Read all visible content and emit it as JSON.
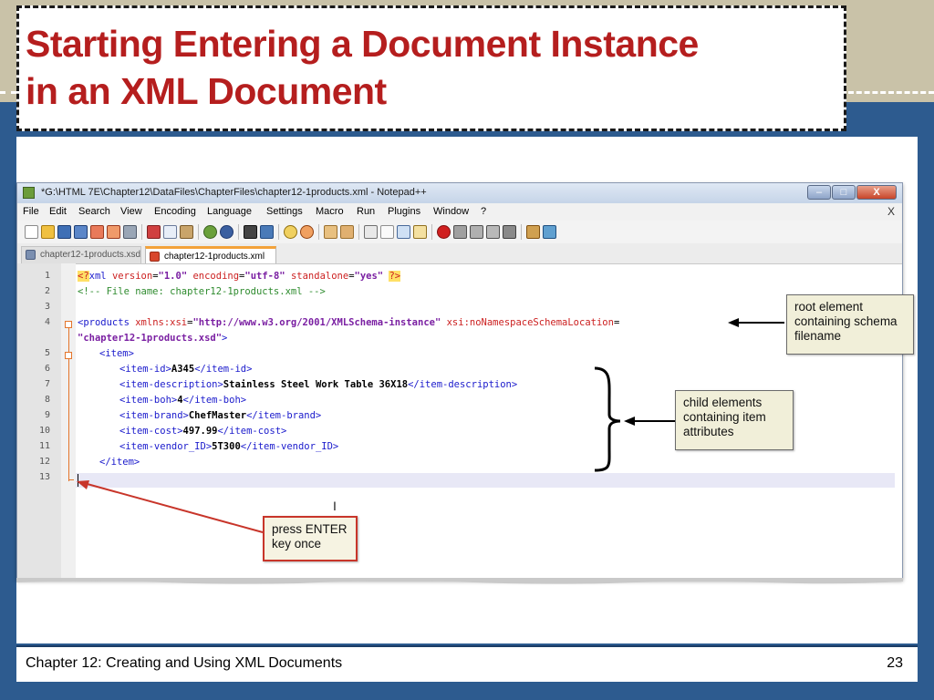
{
  "slide": {
    "title_line1": "Starting Entering a Document Instance",
    "title_line2": "in an XML Document",
    "footer_left": "Chapter 12: Creating and Using XML Documents",
    "page_number": "23",
    "colors": {
      "title": "#b51e1e",
      "band_top": "#c9c2a8",
      "band_blue": "#2d5b8f"
    }
  },
  "window": {
    "title": "*G:\\HTML 7E\\Chapter12\\DataFiles\\ChapterFiles\\chapter12-1products.xml - Notepad++",
    "controls": {
      "minimize": "–",
      "maximize": "□",
      "close": "X"
    },
    "close_doc": "X"
  },
  "menu": [
    "File",
    "Edit",
    "Search",
    "View",
    "Encoding",
    "Language",
    "Settings",
    "Macro",
    "Run",
    "Plugins",
    "Window",
    "?"
  ],
  "tabs": [
    {
      "label": "chapter12-1products.xsd"
    },
    {
      "label": "chapter12-1products.xml"
    }
  ],
  "editor": {
    "line_numbers": [
      "1",
      "2",
      "3",
      "4",
      "",
      "5",
      "6",
      "7",
      "8",
      "9",
      "10",
      "11",
      "12",
      "13"
    ],
    "line1": {
      "open": "<?",
      "tag": "xml",
      "a1": " version",
      "v1": "\"1.0\"",
      "a2": " encoding",
      "v2": "\"utf-8\"",
      "a3": " standalone",
      "v3": "\"yes\"",
      "close": "?>"
    },
    "line2": "<!-- File name: chapter12-1products.xml -->",
    "line4": {
      "tag": "<products",
      "a1": " xmlns:xsi",
      "v1": "\"http://www.w3.org/2001/XMLSchema-instance\"",
      "a2": " xsi:noNamespaceSchemaLocation",
      "eq": "="
    },
    "line4b": {
      "val": "\"chapter12-1products.xsd\"",
      "close": ">"
    },
    "line5": "<item>",
    "rows": [
      {
        "open": "<item-id>",
        "value": "A345",
        "close": "</item-id>"
      },
      {
        "open": "<item-description>",
        "value": "Stainless Steel Work Table 36X18",
        "close": "</item-description>"
      },
      {
        "open": "<item-boh>",
        "value": "4",
        "close": "</item-boh>"
      },
      {
        "open": "<item-brand>",
        "value": "ChefMaster",
        "close": "</item-brand>"
      },
      {
        "open": "<item-cost>",
        "value": "497.99",
        "close": "</item-cost>"
      },
      {
        "open": "<item-vendor_ID>",
        "value": "5T300",
        "close": "</item-vendor_ID>"
      }
    ],
    "line12": "</item>"
  },
  "callouts": {
    "root": "root element containing schema filename",
    "child": "child elements containing item attributes",
    "enter": "press ENTER key once"
  },
  "icons": [
    "new-file-icon",
    "open-icon",
    "save-icon",
    "save-all-icon",
    "close-icon",
    "close-all-icon",
    "print-icon",
    "cut-icon",
    "copy-icon",
    "paste-icon",
    "undo-icon",
    "redo-icon",
    "find-icon",
    "replace-icon",
    "zoom-in-icon",
    "zoom-out-icon",
    "sync-v-icon",
    "sync-h-icon",
    "wrap-icon",
    "all-chars-icon",
    "indent-guide-icon",
    "doc-map-icon",
    "record-macro-icon",
    "stop-macro-icon",
    "play-macro-icon",
    "play-multi-icon",
    "save-macro-icon",
    "launch-icon",
    "spellcheck-icon"
  ]
}
